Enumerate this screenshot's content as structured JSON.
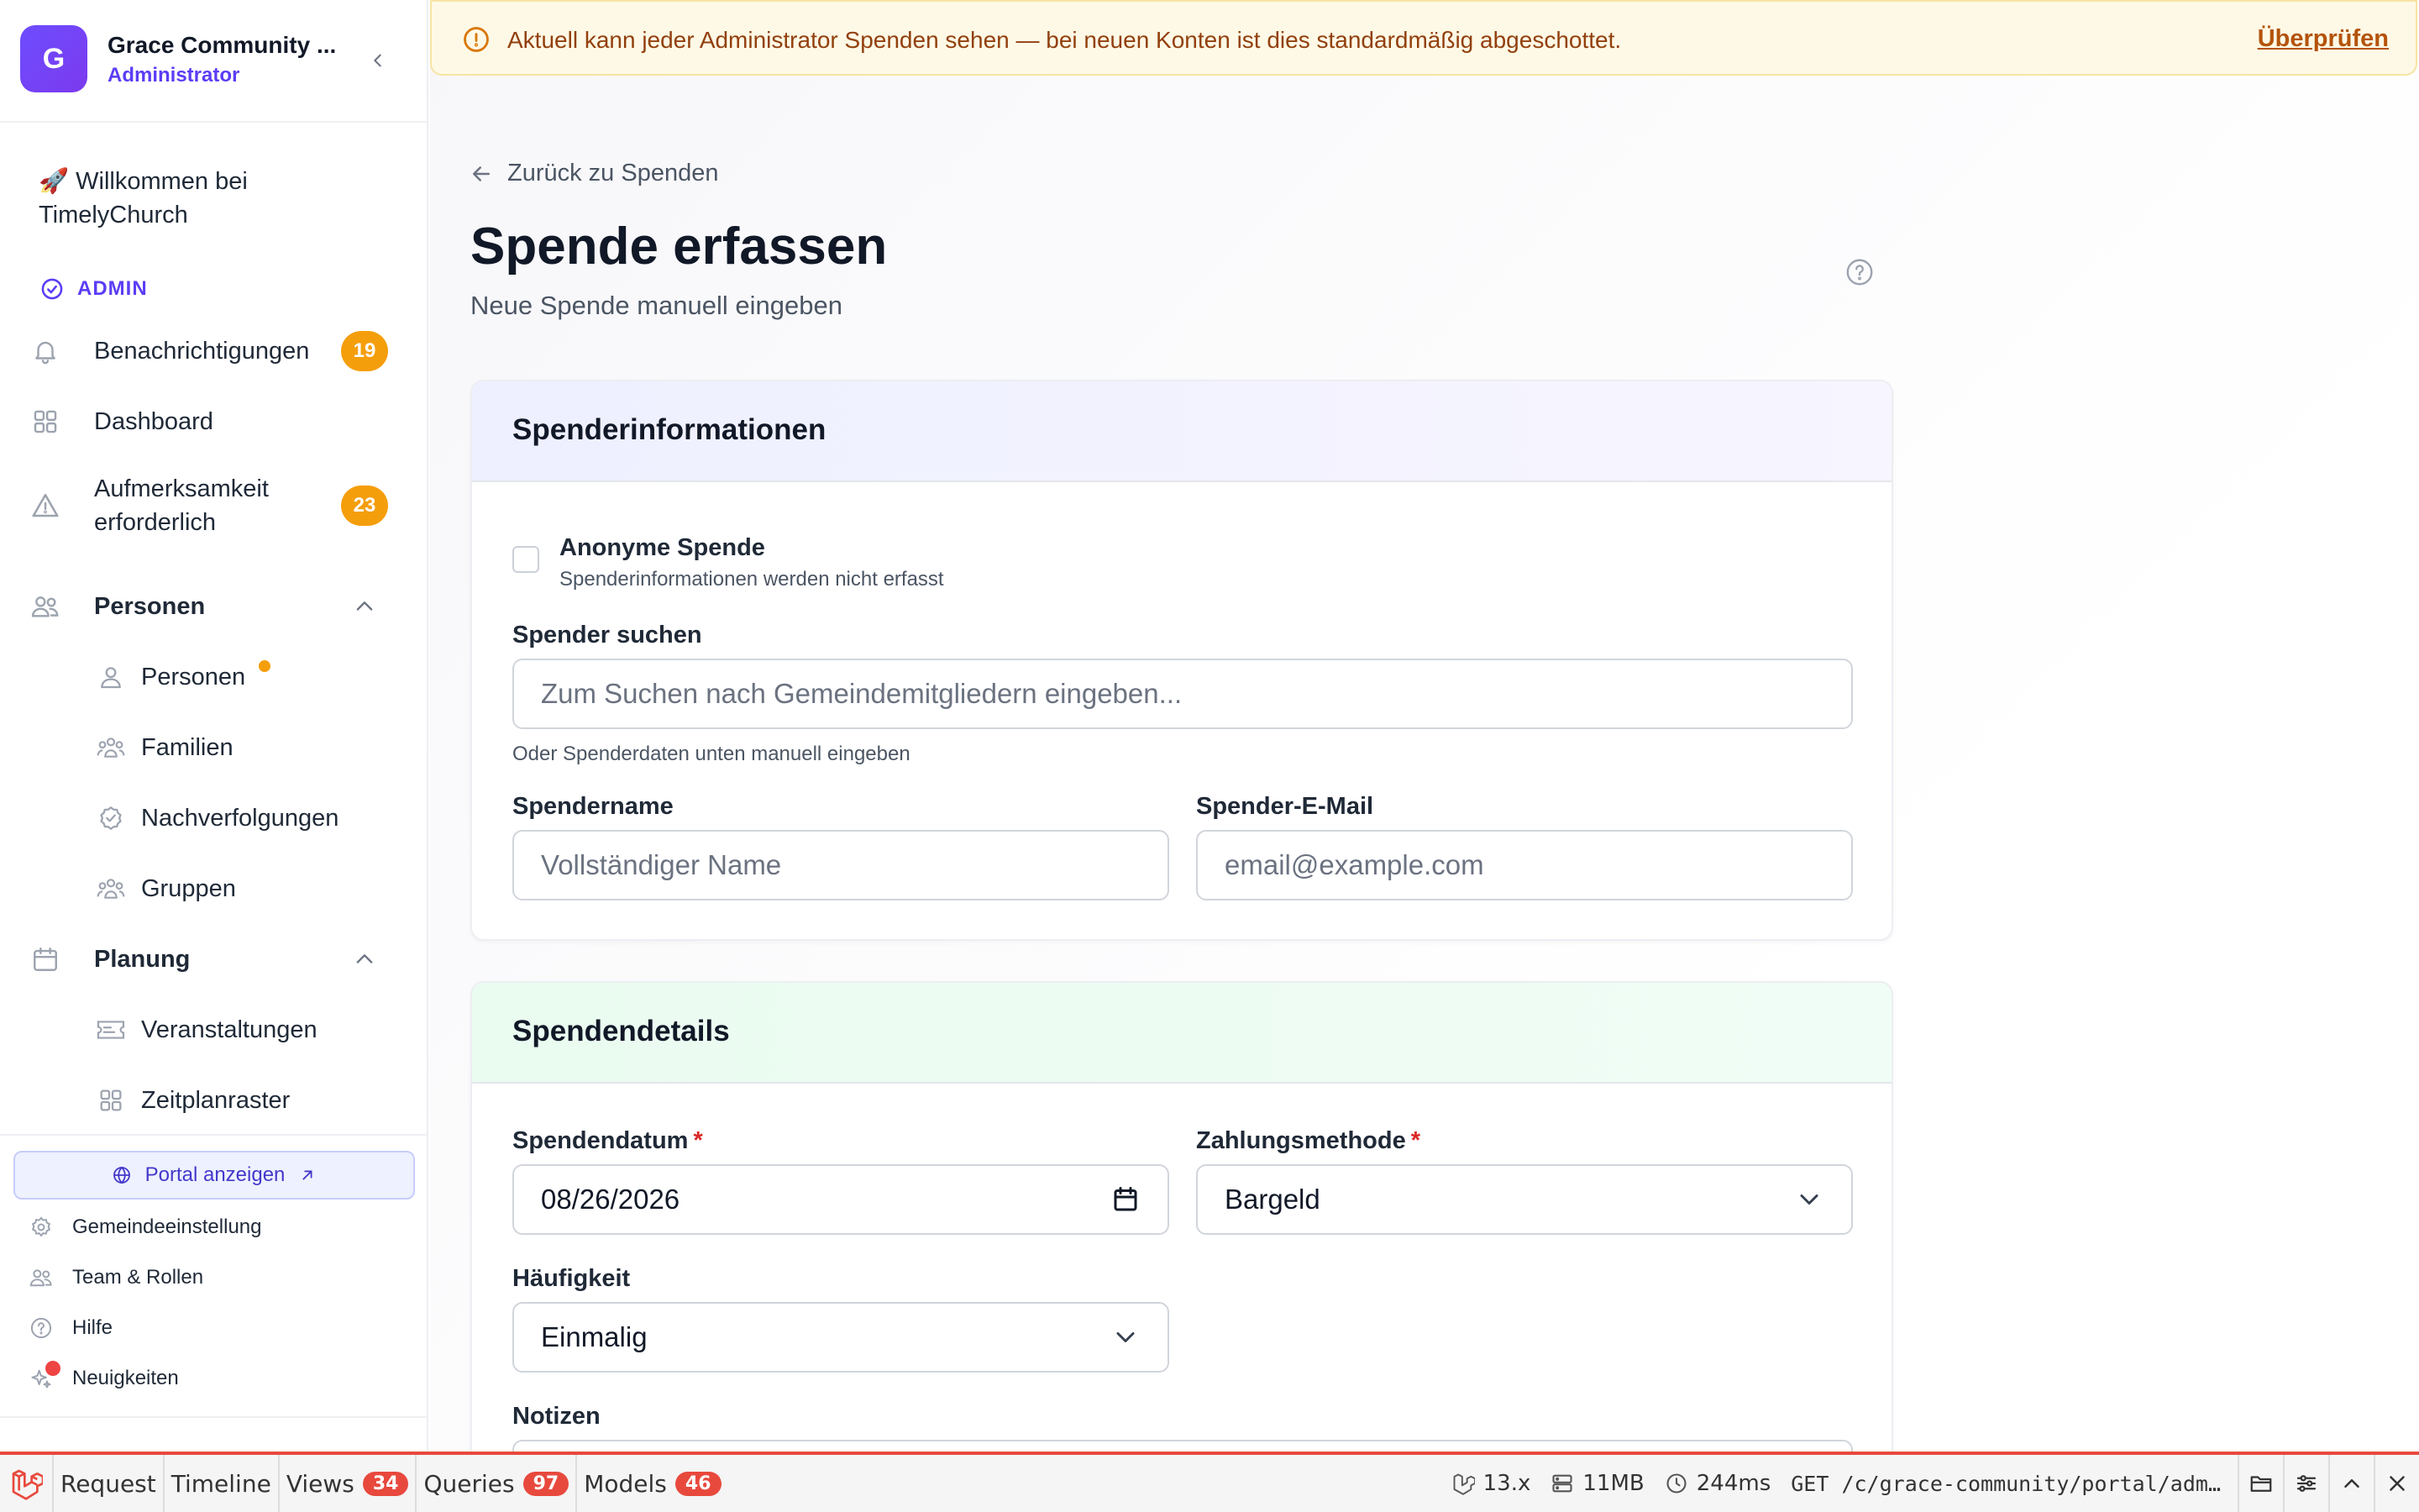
{
  "sidebar": {
    "org_initial": "G",
    "org_name": "Grace Community ...",
    "org_role": "Administrator",
    "welcome": "🚀 Willkommen bei TimelyChurch",
    "admin_label": "ADMIN",
    "items": {
      "notifications": {
        "label": "Benachrichtigungen",
        "badge": "19"
      },
      "dashboard": {
        "label": "Dashboard"
      },
      "attention": {
        "label": "Aufmerksamkeit erforderlich",
        "badge": "23"
      },
      "people_group": {
        "label": "Personen"
      },
      "people": {
        "label": "Personen"
      },
      "families": {
        "label": "Familien"
      },
      "followups": {
        "label": "Nachverfolgungen"
      },
      "groups": {
        "label": "Gruppen"
      },
      "planning_group": {
        "label": "Planung"
      },
      "events": {
        "label": "Veranstaltungen"
      },
      "schedule": {
        "label": "Zeitplanraster"
      }
    },
    "portal_button": "Portal anzeigen",
    "bottom_links": {
      "settings": "Gemeindeeinstellung",
      "team": "Team & Rollen",
      "help": "Hilfe",
      "news": "Neuigkeiten"
    }
  },
  "banner": {
    "text": "Aktuell kann jeder Administrator Spenden sehen — bei neuen Konten ist dies standardmäßig abgeschottet.",
    "link": "Überprüfen"
  },
  "page": {
    "back_link": "Zurück zu Spenden",
    "title": "Spende erfassen",
    "subtitle": "Neue Spende manuell eingeben"
  },
  "donor_card": {
    "title": "Spenderinformationen",
    "anonymous_label": "Anonyme Spende",
    "anonymous_hint": "Spenderinformationen werden nicht erfasst",
    "search_label": "Spender suchen",
    "search_placeholder": "Zum Suchen nach Gemeindemitgliedern eingeben...",
    "search_hint": "Oder Spenderdaten unten manuell eingeben",
    "name_label": "Spendername",
    "name_placeholder": "Vollständiger Name",
    "email_label": "Spender-E-Mail",
    "email_placeholder": "email@example.com"
  },
  "details_card": {
    "title": "Spendendetails",
    "date_label": "Spendendatum",
    "date_value": "08/26/2026",
    "method_label": "Zahlungsmethode",
    "method_value": "Bargeld",
    "frequency_label": "Häufigkeit",
    "frequency_value": "Einmalig",
    "notes_label": "Notizen",
    "required_mark": "*"
  },
  "debugbar": {
    "tabs": {
      "request": {
        "label": "Request"
      },
      "timeline": {
        "label": "Timeline"
      },
      "views": {
        "label": "Views",
        "count": "34"
      },
      "queries": {
        "label": "Queries",
        "count": "97"
      },
      "models": {
        "label": "Models",
        "count": "46"
      }
    },
    "version": "13.x",
    "memory": "11MB",
    "time": "244ms",
    "url": "GET /c/grace-community/portal/adm…"
  },
  "colors": {
    "accent": "#5b3df5",
    "badge": "#f59e0b",
    "banner_bg": "#fef9e6",
    "banner_text": "#92400e",
    "debugbar_red": "#e8493d"
  }
}
